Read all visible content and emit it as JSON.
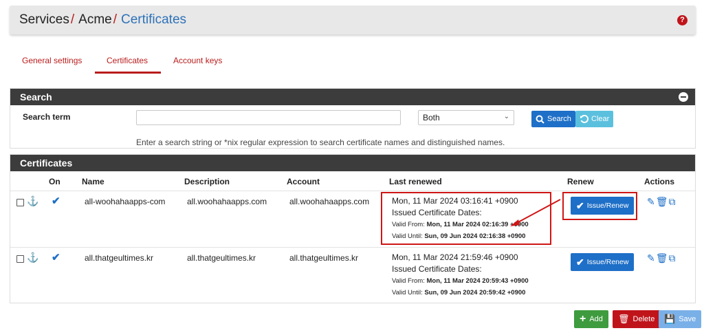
{
  "breadcrumb": {
    "part1": "Services",
    "part2": "Acme",
    "part3": "Certificates",
    "separator": "/"
  },
  "help_icon": "?",
  "tabs": [
    {
      "label": "General settings"
    },
    {
      "label": "Certificates"
    },
    {
      "label": "Account keys"
    }
  ],
  "search_panel": {
    "title": "Search",
    "term_label": "Search term",
    "input_value": "",
    "select_value": "Both",
    "search_button": "Search",
    "clear_button": "Clear",
    "hint": "Enter a search string or *nix regular expression to search certificate names and distinguished names."
  },
  "cert_panel": {
    "title": "Certificates",
    "columns": [
      "On",
      "Name",
      "Description",
      "Account",
      "Last renewed",
      "Renew",
      "Actions"
    ],
    "rows": [
      {
        "name": "all-woohahaapps-com",
        "description": "all.woohahaapps.com",
        "account": "all.woohahaapps.com",
        "renewed": "Mon, 11 Mar 2024 03:16:41 +0900",
        "issued_label": "Issued Certificate Dates:",
        "valid_from_label": "Valid From:",
        "valid_from": "Mon, 11 Mar 2024 02:16:39 +0900",
        "valid_until_label": "Valid Until:",
        "valid_until": "Sun, 09 Jun 2024 02:16:38 +0900",
        "renew_button": "Issue/Renew"
      },
      {
        "name": "all.thatgeultimes.kr",
        "description": "all.thatgeultimes.kr",
        "account": "all.thatgeultimes.kr",
        "renewed": "Mon, 11 Mar 2024 21:59:46 +0900",
        "issued_label": "Issued Certificate Dates:",
        "valid_from_label": "Valid From:",
        "valid_from": "Mon, 11 Mar 2024 20:59:43 +0900",
        "valid_until_label": "Valid Until:",
        "valid_until": "Sun, 09 Jun 2024 20:59:42 +0900",
        "renew_button": "Issue/Renew"
      }
    ]
  },
  "bottom_buttons": {
    "add": "Add",
    "delete": "Delete",
    "save": "Save"
  },
  "colors": {
    "accent_red": "#b91c1c",
    "primary_blue": "#1e6fc7",
    "header_dark": "#3c3c3c"
  }
}
